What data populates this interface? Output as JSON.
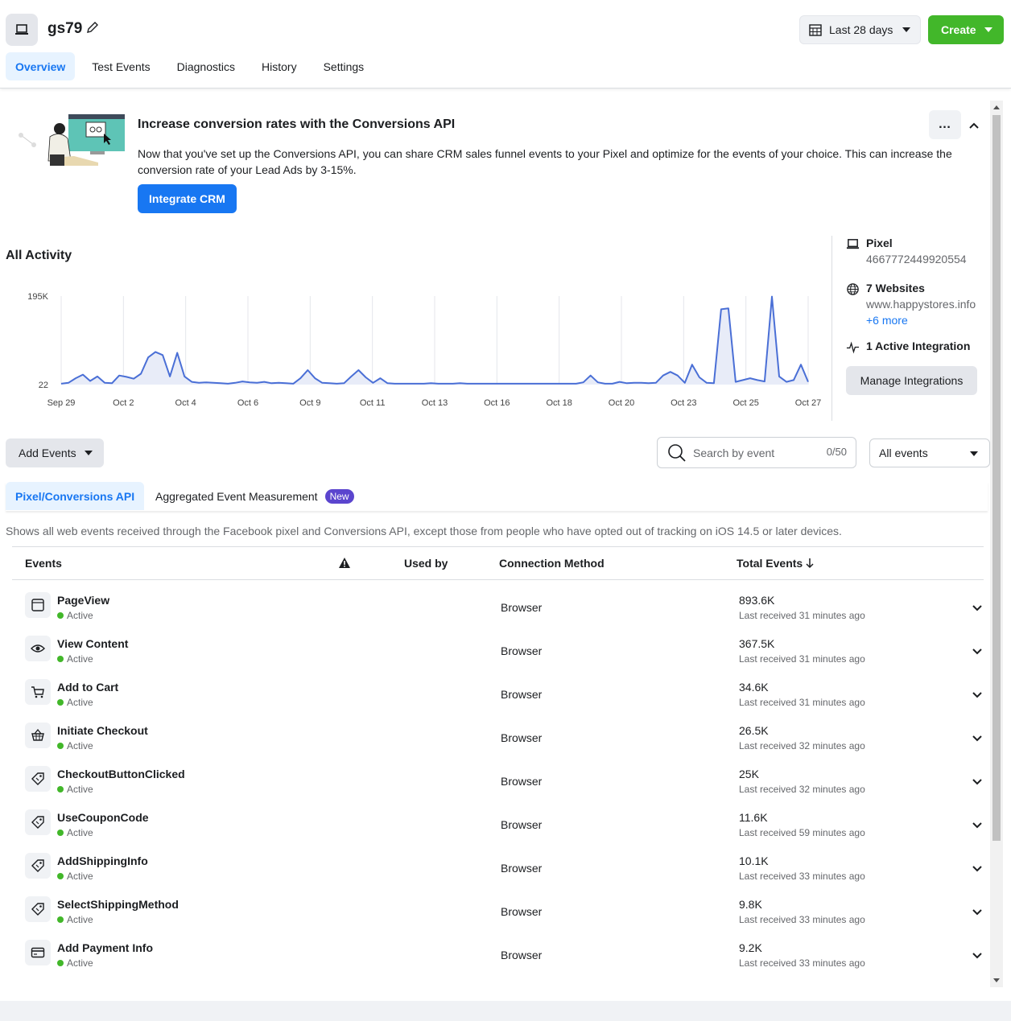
{
  "header": {
    "title": "gs79",
    "date_range": "Last 28 days",
    "create_label": "Create",
    "tabs": [
      {
        "label": "Overview",
        "active": true
      },
      {
        "label": "Test Events"
      },
      {
        "label": "Diagnostics"
      },
      {
        "label": "History"
      },
      {
        "label": "Settings"
      }
    ]
  },
  "banner": {
    "title": "Increase conversion rates with the Conversions API",
    "text": "Now that you've set up the Conversions API, you can share CRM sales funnel events to your Pixel and optimize for the events of your choice. This can increase the conversion rate of your Lead Ads by 3-15%.",
    "button": "Integrate CRM",
    "more": "…"
  },
  "activity": {
    "title": "All Activity"
  },
  "chart_data": {
    "type": "area",
    "ytick_labels": [
      "195K",
      "22"
    ],
    "ylim": [
      22,
      195000
    ],
    "x_labels": [
      "Sep 29",
      "Oct 2",
      "Oct 4",
      "Oct 6",
      "Oct 9",
      "Oct 11",
      "Oct 13",
      "Oct 16",
      "Oct 18",
      "Oct 20",
      "Oct 23",
      "Oct 25",
      "Oct 27"
    ],
    "values": [
      2000,
      4000,
      14000,
      22000,
      8000,
      18000,
      4000,
      3000,
      20000,
      17000,
      13000,
      24000,
      60000,
      72000,
      65000,
      18000,
      70000,
      18000,
      6000,
      4000,
      5000,
      4000,
      3000,
      2000,
      4000,
      7000,
      5000,
      4000,
      6000,
      3000,
      4000,
      3000,
      2000,
      14000,
      32000,
      14000,
      4000,
      3000,
      2000,
      3000,
      18000,
      32000,
      16000,
      4000,
      14000,
      3000,
      2000,
      2000,
      2000,
      2000,
      2000,
      3000,
      2000,
      2000,
      2000,
      3000,
      2000,
      2000,
      2000,
      2000,
      2000,
      2000,
      2000,
      2000,
      2000,
      2000,
      2000,
      2000,
      2000,
      2000,
      2000,
      2000,
      5000,
      20000,
      5000,
      2000,
      2000,
      6000,
      3000,
      4000,
      4000,
      3000,
      4000,
      20000,
      28000,
      20000,
      4000,
      44000,
      16000,
      4000,
      3000,
      166000,
      168000,
      6000,
      10000,
      14000,
      10000,
      7000,
      194000,
      18000,
      6000,
      10000,
      44000,
      6000
    ],
    "color": "#4a6fd6",
    "grid": true
  },
  "sidebar": {
    "pixel_label": "Pixel",
    "pixel_id": "4667772449920554",
    "websites_label": "7 Websites",
    "website": "www.happystores.info",
    "more_link": "+6 more",
    "integration_label": "1 Active Integration",
    "manage_button": "Manage Integrations"
  },
  "controls": {
    "add_events": "Add Events",
    "search_placeholder": "Search by event",
    "search_count": "0/50",
    "filter": "All events"
  },
  "subtabs": {
    "primary": "Pixel/Conversions API",
    "secondary": "Aggregated Event Measurement",
    "badge": "New"
  },
  "description": "Shows all web events received through the Facebook pixel and Conversions API, except those from people who have opted out of tracking on iOS 14.5 or later devices.",
  "table": {
    "headers": {
      "events": "Events",
      "used_by": "Used by",
      "method": "Connection Method",
      "total": "Total Events"
    },
    "rows": [
      {
        "name": "PageView",
        "status": "Active",
        "method": "Browser",
        "total": "893.6K",
        "last": "Last received 31 minutes ago",
        "icon": "page-icon"
      },
      {
        "name": "View Content",
        "status": "Active",
        "method": "Browser",
        "total": "367.5K",
        "last": "Last received 31 minutes ago",
        "icon": "eye-icon"
      },
      {
        "name": "Add to Cart",
        "status": "Active",
        "method": "Browser",
        "total": "34.6K",
        "last": "Last received 31 minutes ago",
        "icon": "cart-icon"
      },
      {
        "name": "Initiate Checkout",
        "status": "Active",
        "method": "Browser",
        "total": "26.5K",
        "last": "Last received 32 minutes ago",
        "icon": "basket-icon"
      },
      {
        "name": "CheckoutButtonClicked",
        "status": "Active",
        "method": "Browser",
        "total": "25K",
        "last": "Last received 32 minutes ago",
        "icon": "tag-icon"
      },
      {
        "name": "UseCouponCode",
        "status": "Active",
        "method": "Browser",
        "total": "11.6K",
        "last": "Last received 59 minutes ago",
        "icon": "tag-icon"
      },
      {
        "name": "AddShippingInfo",
        "status": "Active",
        "method": "Browser",
        "total": "10.1K",
        "last": "Last received 33 minutes ago",
        "icon": "tag-icon"
      },
      {
        "name": "SelectShippingMethod",
        "status": "Active",
        "method": "Browser",
        "total": "9.8K",
        "last": "Last received 33 minutes ago",
        "icon": "tag-icon"
      },
      {
        "name": "Add Payment Info",
        "status": "Active",
        "method": "Browser",
        "total": "9.2K",
        "last": "Last received 33 minutes ago",
        "icon": "card-icon"
      }
    ]
  }
}
